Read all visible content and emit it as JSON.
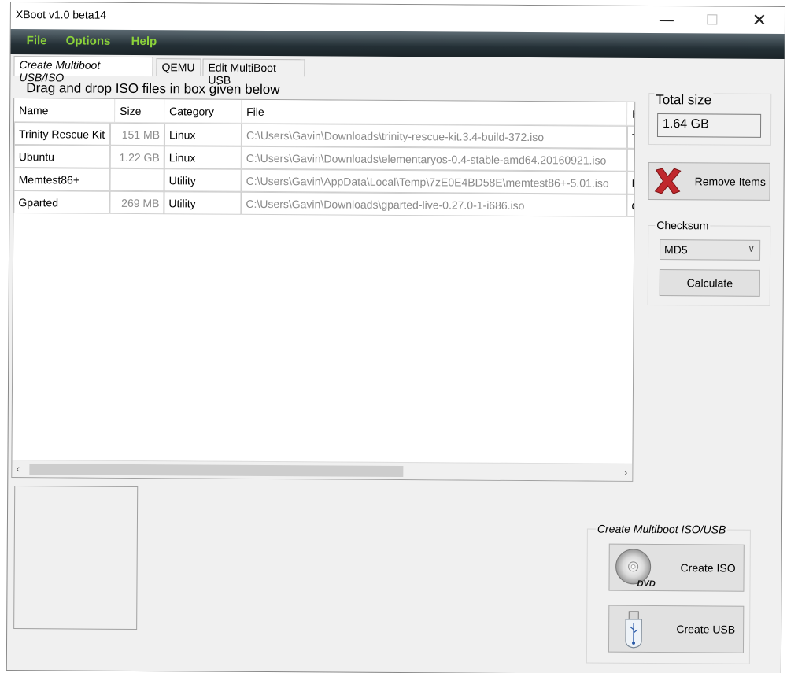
{
  "window": {
    "title": "XBoot v1.0 beta14"
  },
  "menu": [
    "File",
    "Options",
    "Help"
  ],
  "tabs": [
    "Create Multiboot USB/ISO",
    "QEMU",
    "Edit MultiBoot USB"
  ],
  "drag_label": "Drag and drop ISO files in box given below",
  "table": {
    "columns": [
      "Name",
      "Size",
      "Category",
      "File",
      "H"
    ],
    "rows": [
      {
        "name": "Trinity Rescue Kit",
        "size": "151 MB",
        "category": "Linux",
        "file": "C:\\Users\\Gavin\\Downloads\\trinity-rescue-kit.3.4-build-372.iso",
        "extra": "T"
      },
      {
        "name": "Ubuntu",
        "size": "1.22 GB",
        "category": "Linux",
        "file": "C:\\Users\\Gavin\\Downloads\\elementaryos-0.4-stable-amd64.20160921.iso",
        "extra": ""
      },
      {
        "name": "Memtest86+",
        "size": "",
        "category": "Utility",
        "file": "C:\\Users\\Gavin\\AppData\\Local\\Temp\\7zE0E4BD58E\\memtest86+-5.01.iso",
        "extra": "M"
      },
      {
        "name": "Gparted",
        "size": "269 MB",
        "category": "Utility",
        "file": "C:\\Users\\Gavin\\Downloads\\gparted-live-0.27.0-1-i686.iso",
        "extra": "G"
      }
    ]
  },
  "total_size": {
    "label": "Total size",
    "value": "1.64 GB"
  },
  "remove_items": "Remove Items",
  "checksum": {
    "label": "Checksum",
    "selected": "MD5",
    "calculate": "Calculate"
  },
  "create": {
    "label": "Create Multiboot ISO/USB",
    "iso": "Create ISO",
    "usb": "Create USB",
    "dvd_text": "DVD"
  },
  "icons": {
    "remove": "red-x-icon",
    "iso": "dvd-icon",
    "usb": "usb-drive-icon"
  }
}
